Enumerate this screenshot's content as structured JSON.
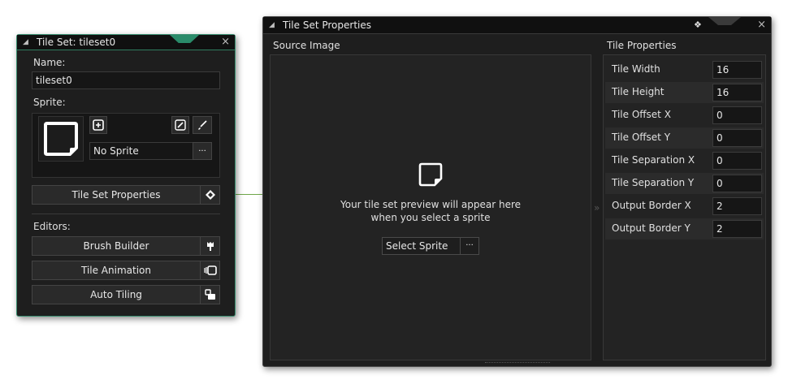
{
  "left_panel": {
    "title": "Tile Set: tileset0",
    "close": "×",
    "name_label": "Name:",
    "name_value": "tileset0",
    "sprite_label": "Sprite:",
    "sprite_value": "No Sprite",
    "sprite_more": "···",
    "properties_button": "Tile Set Properties",
    "editors_label": "Editors:",
    "editors": [
      "Brush Builder",
      "Tile Animation",
      "Auto Tiling"
    ]
  },
  "right_panel": {
    "title": "Tile Set Properties",
    "close": "×",
    "source_label": "Source Image",
    "preview_line1": "Your tile set preview will appear here",
    "preview_line2": "when you select a sprite",
    "select_button": "Select Sprite",
    "select_more": "···",
    "splitter": "»",
    "props_label": "Tile Properties",
    "properties": [
      {
        "label": "Tile Width",
        "value": "16"
      },
      {
        "label": "Tile Height",
        "value": "16"
      },
      {
        "label": "Tile Offset X",
        "value": "0"
      },
      {
        "label": "Tile Offset Y",
        "value": "0"
      },
      {
        "label": "Tile Separation X",
        "value": "0"
      },
      {
        "label": "Tile Separation Y",
        "value": "0"
      },
      {
        "label": "Output Border X",
        "value": "2"
      },
      {
        "label": "Output Border Y",
        "value": "2"
      }
    ]
  },
  "colors": {
    "panel_bg": "#1e1e1e",
    "title_bg": "#101010",
    "accent_green": "#3a8e70",
    "field_bg": "#161616",
    "text": "#e8e8e8"
  },
  "icons": [
    "collapse-icon",
    "close-icon",
    "pin-icon",
    "sprite-thumbnail-icon",
    "add-sprite-icon",
    "edit-sprite-icon",
    "brush-icon",
    "tileset-properties-icon",
    "brush-builder-icon",
    "tile-animation-icon",
    "auto-tiling-icon",
    "preview-placeholder-icon"
  ]
}
